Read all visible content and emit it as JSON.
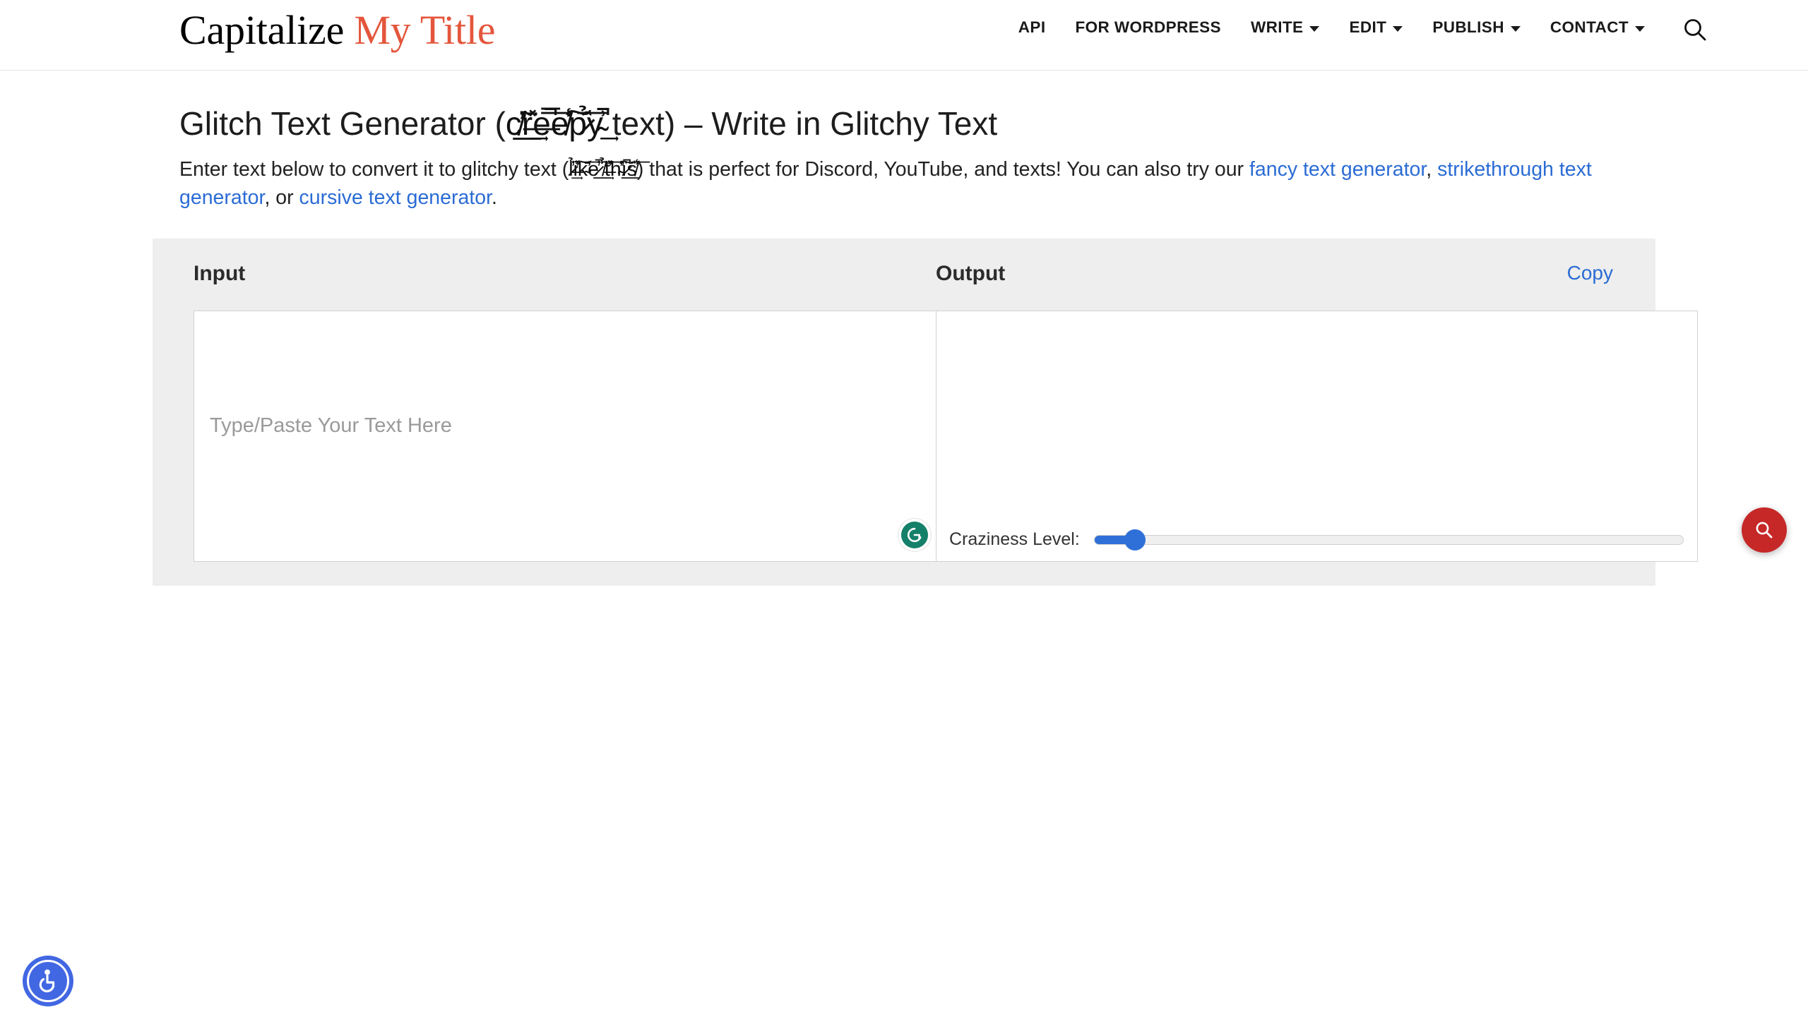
{
  "header": {
    "logo": {
      "part_a": "Capitalize",
      "part_b": "My Title",
      "accent_color": "#e4563c"
    },
    "nav": [
      {
        "label": "API",
        "has_caret": false
      },
      {
        "label": "FOR WORDPRESS",
        "has_caret": false
      },
      {
        "label": "WRITE",
        "has_caret": true
      },
      {
        "label": "EDIT",
        "has_caret": true
      },
      {
        "label": "PUBLISH",
        "has_caret": true
      },
      {
        "label": "CONTACT",
        "has_caret": true
      }
    ],
    "search_icon": "search-icon"
  },
  "page": {
    "title_plain": "Glitch Text Generator (creepy text) – Write in Glitchy Text",
    "title_before": "Glitch Text Generator (",
    "title_glitch": "c̸̛̃̓͟r̶̽̈͢e̶̅̚͞e̸̍̾͠p̷̉̑͞y̴͗̚͢",
    "title_after": " text) – Write in Glitchy Text",
    "desc_part1": "Enter text below to convert it to glitchy text (",
    "desc_glitch": "l̷̉̓͢i̶̽̕͠k̴̛̈͞e̷̓̚͟ ̸̉̑͢t̶̽̓͞h̴̛̕͠ï̷̚͟s̸̑̾͞",
    "desc_part2": ") that is perfect for Discord, YouTube, and texts! You can also try our ",
    "link_fancy": "fancy text generator",
    "desc_comma": ", ",
    "link_strike": "strikethrough text generator",
    "desc_or": ", or ",
    "link_cursive": "cursive text generator",
    "desc_period": "."
  },
  "tool": {
    "input": {
      "heading": "Input",
      "value": "",
      "placeholder": "Type/Paste Your Text Here",
      "grammarly_icon": "grammarly-icon"
    },
    "output": {
      "heading": "Output",
      "copy_label": "Copy",
      "value": "",
      "placeholder": "",
      "slider": {
        "label": "Craziness Level:",
        "value": 7,
        "min": 0,
        "max": 100,
        "accent_color": "#2f70d8"
      }
    }
  },
  "floating": {
    "search_fab": {
      "icon": "search-icon",
      "color": "#c62828"
    },
    "accessibility": {
      "icon": "wheelchair-accessibility-icon",
      "color": "#4267e2"
    }
  }
}
